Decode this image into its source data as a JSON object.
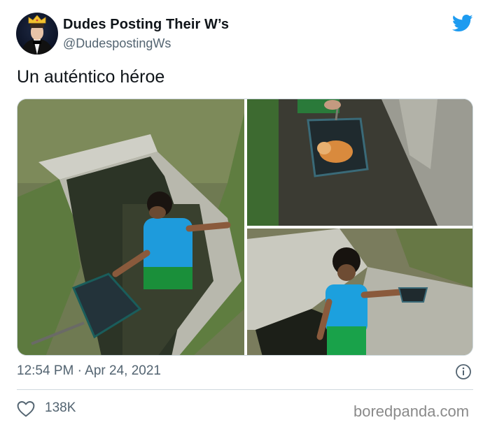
{
  "author": {
    "name": "Dudes Posting Their W’s",
    "handle": "@DudespostingWs"
  },
  "tweet": {
    "text": "Un auténtico héroe",
    "timestamp": "12:54 PM · Apr 24, 2021",
    "likes": "138K"
  },
  "icons": {
    "brand": "twitter-bird-icon",
    "info": "info-icon",
    "like": "heart-icon"
  },
  "colors": {
    "brand_blue": "#1d9bf0",
    "secondary_text": "#536471",
    "border": "#cfd9de"
  },
  "watermark": "boredpanda.com"
}
